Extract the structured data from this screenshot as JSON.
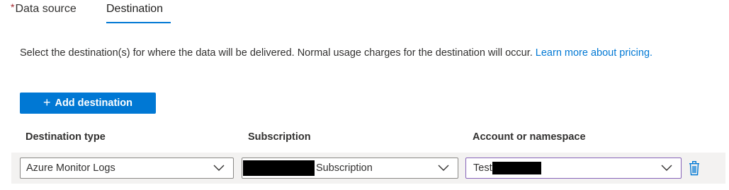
{
  "tabs": {
    "data_source": {
      "required_marker": "*",
      "label": "Data source"
    },
    "destination": {
      "label": "Destination"
    }
  },
  "description": {
    "text": "Select the destination(s) for where the data will be delivered. Normal usage charges for the destination will occur. ",
    "link_text": "Learn more about pricing."
  },
  "add_button": {
    "icon": "plus-icon",
    "label": "Add destination"
  },
  "table": {
    "headers": [
      "Destination type",
      "Subscription",
      "Account or namespace"
    ],
    "row": {
      "destination_type": "Azure Monitor Logs",
      "subscription": "Subscription",
      "account": "Test"
    }
  },
  "colors": {
    "accent": "#0078d4",
    "required": "#a4262c",
    "focus_border": "#8764b8",
    "row_background": "#f3f2f1"
  },
  "icons": {
    "dropdown": "chevron-down-icon",
    "delete": "trash-icon"
  }
}
